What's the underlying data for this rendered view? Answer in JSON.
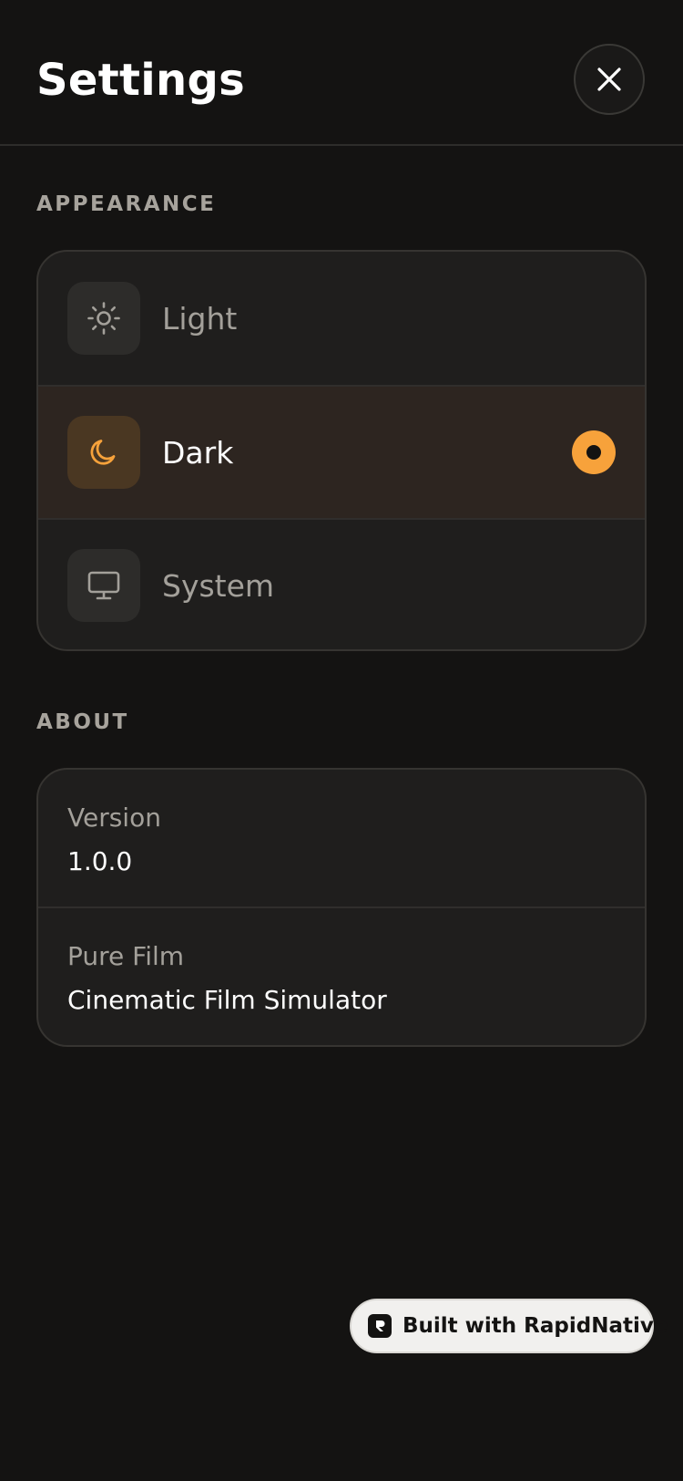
{
  "header": {
    "title": "Settings",
    "close_icon": "close-icon"
  },
  "appearance": {
    "label": "APPEARANCE",
    "options": [
      {
        "label": "Light",
        "icon": "sun-icon",
        "selected": false
      },
      {
        "label": "Dark",
        "icon": "moon-icon",
        "selected": true
      },
      {
        "label": "System",
        "icon": "monitor-icon",
        "selected": false
      }
    ]
  },
  "about": {
    "label": "ABOUT",
    "rows": [
      {
        "key": "Version",
        "value": "1.0.0"
      },
      {
        "key": "Pure Film",
        "value": "Cinematic Film Simulator"
      }
    ]
  },
  "badge": {
    "text": "Built with RapidNative",
    "icon": "rapidnative-logo-icon"
  },
  "colors": {
    "background": "#141312",
    "card": "#1f1e1d",
    "accent": "#f7a23b",
    "selected_row": "#2d2520",
    "muted_text": "#a3a09a"
  }
}
